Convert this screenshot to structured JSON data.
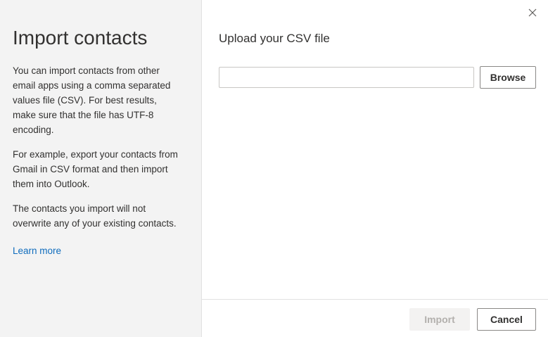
{
  "left": {
    "title": "Import contacts",
    "paragraphs": [
      "You can import contacts from other email apps using a comma separated values file (CSV). For best results, make sure that the file has UTF-8 encoding.",
      "For example, export your contacts from Gmail in CSV format and then import them into Outlook.",
      "The contacts you import will not overwrite any of your existing contacts."
    ],
    "learn_more": "Learn more"
  },
  "right": {
    "title": "Upload your CSV file",
    "file_input": {
      "value": "",
      "placeholder": ""
    },
    "browse_label": "Browse"
  },
  "footer": {
    "import_label": "Import",
    "cancel_label": "Cancel"
  },
  "icons": {
    "close": "close-icon"
  },
  "colors": {
    "link": "#0f6cbd",
    "left_pane_bg": "#f3f3f3",
    "disabled_text": "#b3b0ad"
  }
}
